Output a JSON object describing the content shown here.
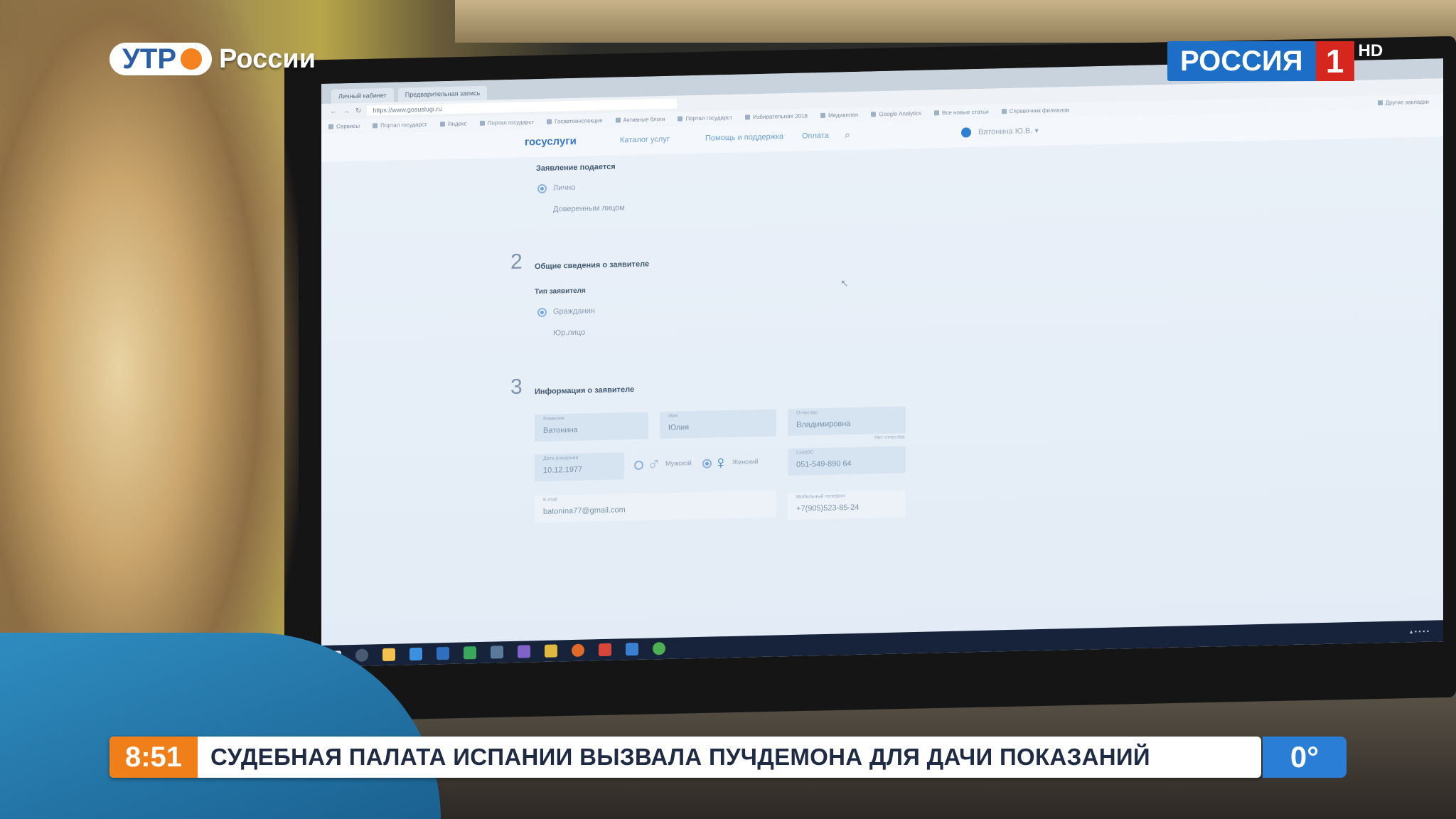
{
  "broadcast": {
    "show_logo_text": "УТР",
    "show_logo_suffix": "России",
    "channel_name": "РОССИЯ",
    "channel_number": "1",
    "channel_quality": "HD",
    "ticker": {
      "time": "8:51",
      "headline": "СУДЕБНАЯ ПАЛАТА ИСПАНИИ ВЫЗВАЛА ПУЧДЕМОНА ДЛЯ ДАЧИ ПОКАЗАНИЙ",
      "temperature": "0°"
    },
    "colors": {
      "orange": "#f07f19",
      "blue": "#2b7ed6",
      "red": "#d6261e"
    }
  },
  "browser": {
    "tabs": [
      "Личный кабинет",
      "Предварительная запись"
    ],
    "url": "https://www.gosuslugi.ru",
    "bookmarks": [
      "Сервисы",
      "Портал государст",
      "Яндекс",
      "Портал государст",
      "Госавтоинспекция",
      "Активные блоги",
      "Портал государст",
      "Избирательная 2018",
      "Медиаплан",
      "Google Analytics",
      "Все новые статьи",
      "Справочник филиалов"
    ],
    "bookmarks_right": "Другие закладки"
  },
  "site": {
    "logo": "госуслуги",
    "nav": [
      "Каталог услуг",
      "Помощь и поддержка",
      "Оплата"
    ],
    "user_name": "Ватонина Ю.В."
  },
  "form": {
    "section1": {
      "title": "Заявление подается",
      "options": [
        "Лично",
        "Доверенным лицом"
      ]
    },
    "section2": {
      "number": "2",
      "title": "Общие сведения о заявителе",
      "subtitle": "Тип заявителя",
      "options": [
        "Gражданин",
        "Юр.лицо"
      ]
    },
    "section3": {
      "number": "3",
      "title": "Информация о заявителе",
      "fields": {
        "surname": {
          "label": "Фамилия",
          "value": "Ватонина"
        },
        "name": {
          "label": "Имя",
          "value": "Юлия"
        },
        "patronymic": {
          "label": "Отчество",
          "value": "Владимировна"
        },
        "no_patronymic": "Нет отчества",
        "birthdate": {
          "label": "Дата рождения",
          "value": "10.12.1977"
        },
        "gender_male": "Мужской",
        "gender_female": "Женский",
        "snils": {
          "label": "СНИЛС",
          "value": "051-549-890 64"
        },
        "email": {
          "label": "E-mail",
          "value": "batonina77@gmail.com"
        },
        "phone": {
          "label": "Мобильный телефон",
          "value": "+7(905)523-85-24"
        }
      }
    }
  }
}
